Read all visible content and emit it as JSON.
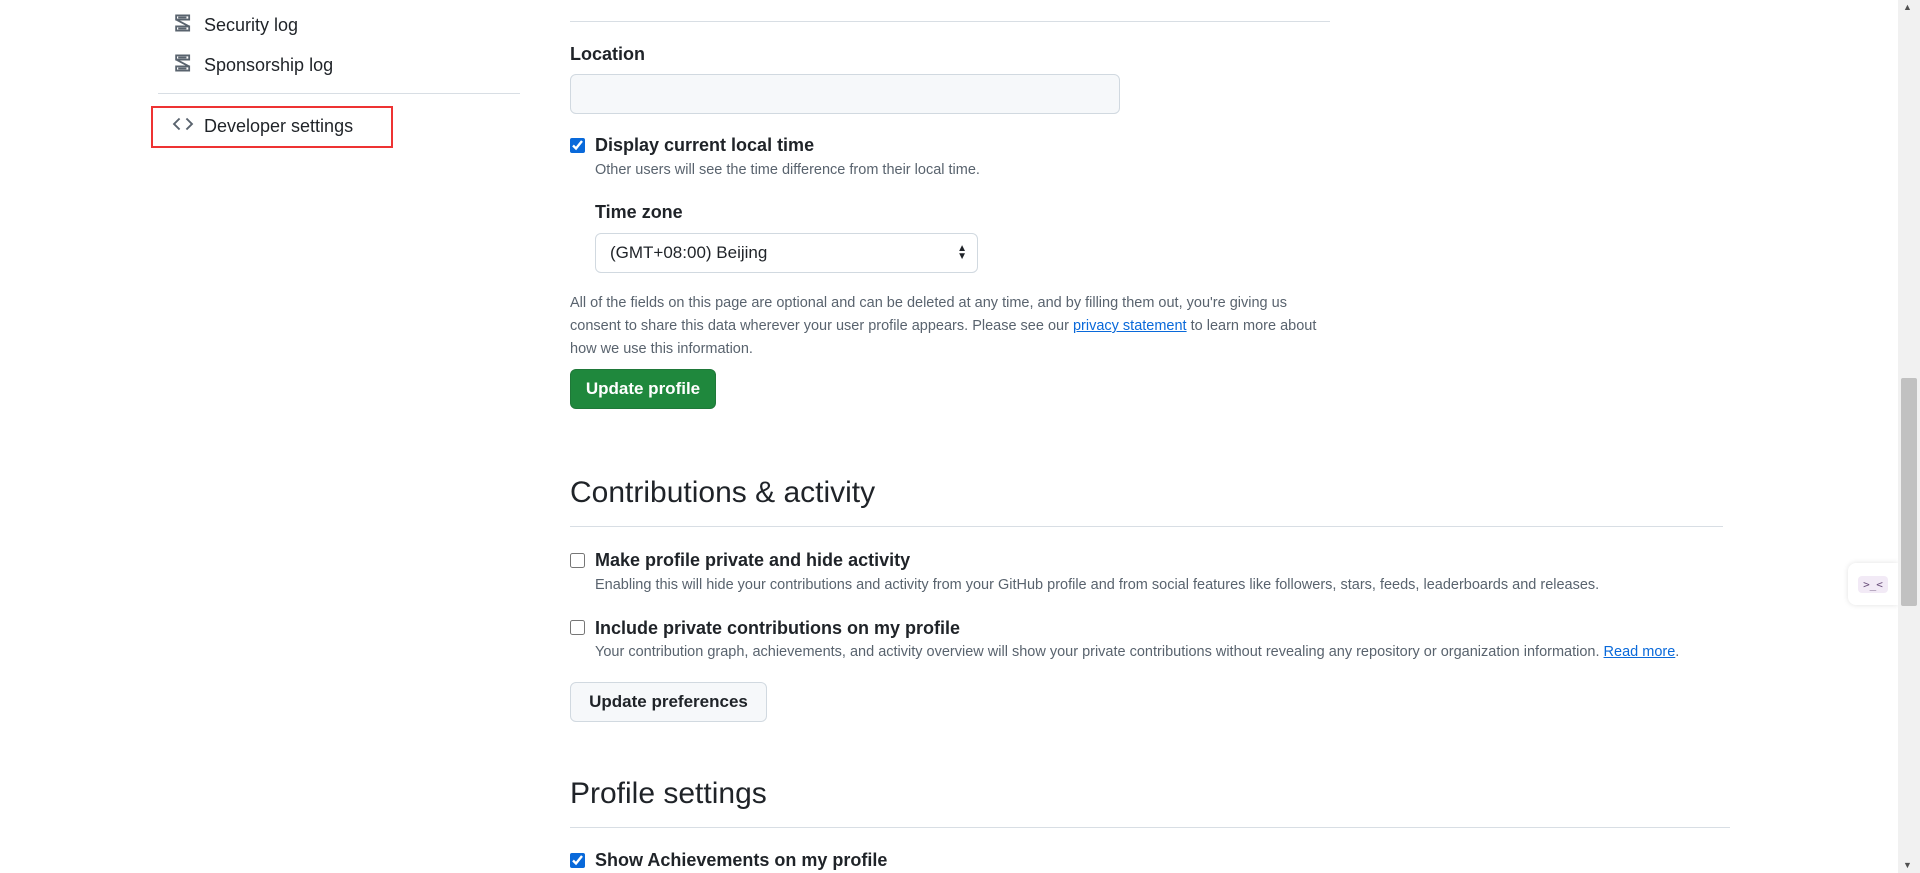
{
  "sidebar": {
    "items": [
      {
        "label": "Security log",
        "icon": "log-icon"
      },
      {
        "label": "Sponsorship log",
        "icon": "log-icon"
      },
      {
        "label": "Developer settings",
        "icon": "code-icon"
      }
    ]
  },
  "profile": {
    "location_label": "Location",
    "location_value": "",
    "local_time_label": "Display current local time",
    "local_time_checked": true,
    "local_time_note": "Other users will see the time difference from their local time.",
    "timezone_label": "Time zone",
    "timezone_value": "(GMT+08:00) Beijing",
    "consent_before": "All of the fields on this page are optional and can be deleted at any time, and by filling them out, you're giving us consent to share this data wherever your user profile appears. Please see our ",
    "consent_link": "privacy statement",
    "consent_after": " to learn more about how we use this information.",
    "update_button": "Update profile"
  },
  "contributions": {
    "heading": "Contributions & activity",
    "private_title": "Make profile private and hide activity",
    "private_checked": false,
    "private_note": "Enabling this will hide your contributions and activity from your GitHub profile and from social features like followers, stars, feeds, leaderboards and releases.",
    "include_title": "Include private contributions on my profile",
    "include_checked": false,
    "include_note": "Your contribution graph, achievements, and activity overview will show your private contributions without revealing any repository or organization information. ",
    "include_link": "Read more",
    "include_suffix": ".",
    "update_button": "Update preferences"
  },
  "profile_settings": {
    "heading": "Profile settings",
    "achievements_title": "Show Achievements on my profile",
    "achievements_checked": true
  },
  "widget": {
    "text": ">_<"
  },
  "colors": {
    "primary_button": "#1f883d",
    "link": "#0969da",
    "highlight_box": "#ee3333"
  }
}
